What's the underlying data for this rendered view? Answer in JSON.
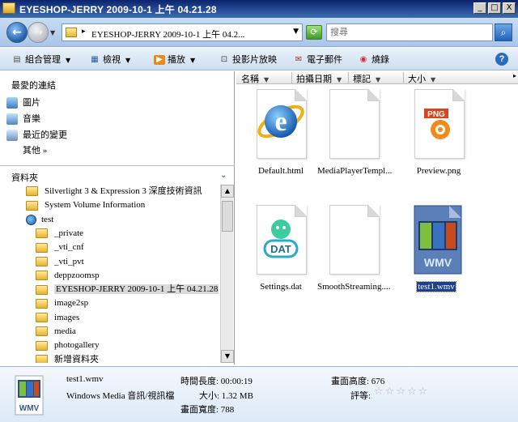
{
  "window": {
    "title": "EYESHOP-JERRY 2009-10-1 上午 04.21.28",
    "buttons": {
      "minimize": "_",
      "maximize": "□",
      "close": "X"
    }
  },
  "address": {
    "path": "EYESHOP-JERRY 2009-10-1 上午 04.2...",
    "search_placeholder": "搜尋",
    "back_icon": "back-arrow-icon",
    "forward_icon": "forward-arrow-icon"
  },
  "toolbar": {
    "organize": "組合管理",
    "views": "檢視",
    "play": "播放",
    "slideshow": "投影片放映",
    "email": "電子郵件",
    "burn": "燒錄"
  },
  "favorites": {
    "heading": "最愛的連結",
    "items": [
      {
        "label": "圖片",
        "icon": "pictures-icon"
      },
      {
        "label": "音樂",
        "icon": "music-icon"
      },
      {
        "label": "最近的變更",
        "icon": "recent-changes-icon"
      }
    ],
    "more": "其他 »"
  },
  "folders": {
    "heading": "資料夾",
    "tree": [
      {
        "label": "Silverlight 3 & Expression 3 深度技術資訊",
        "level": 0
      },
      {
        "label": "System Volume Information",
        "level": 0
      },
      {
        "label": "test",
        "level": 0,
        "type": "globe"
      },
      {
        "label": "_private",
        "level": 1
      },
      {
        "label": "_vti_cnf",
        "level": 1
      },
      {
        "label": "_vti_pvt",
        "level": 1
      },
      {
        "label": "deppzoomsp",
        "level": 1
      },
      {
        "label": "EYESHOP-JERRY 2009-10-1 上午 04.21.28",
        "level": 1,
        "selected": true
      },
      {
        "label": "image2sp",
        "level": 1
      },
      {
        "label": "images",
        "level": 1
      },
      {
        "label": "media",
        "level": 1
      },
      {
        "label": "photogallery",
        "level": 1
      },
      {
        "label": "新增資料夾",
        "level": 1
      }
    ]
  },
  "columns": [
    "名稱",
    "拍攝日期",
    "標記",
    "大小"
  ],
  "files": [
    {
      "name": "Default.html",
      "kind": "ie-html"
    },
    {
      "name": "MediaPlayerTempl...",
      "kind": "blank"
    },
    {
      "name": "Preview.png",
      "kind": "png"
    },
    {
      "name": "Settings.dat",
      "kind": "dat"
    },
    {
      "name": "SmoothStreaming....",
      "kind": "blank"
    },
    {
      "name": "test1.wmv",
      "kind": "wmv",
      "selected": true
    }
  ],
  "file_badges": {
    "png": "PNG",
    "dat": "DAT",
    "wmv": "WMV"
  },
  "details": {
    "filename": "test1.wmv",
    "filetype": "Windows Media 音訊/視訊檔",
    "duration": "時間長度: 00:00:19",
    "size": "大小: 1.32 MB",
    "frame_width": "畫面寬度: 788",
    "frame_height": "畫面高度: 676",
    "rating_label": "評等:",
    "rating_stars": "☆☆☆☆☆",
    "rating_value": 0
  }
}
